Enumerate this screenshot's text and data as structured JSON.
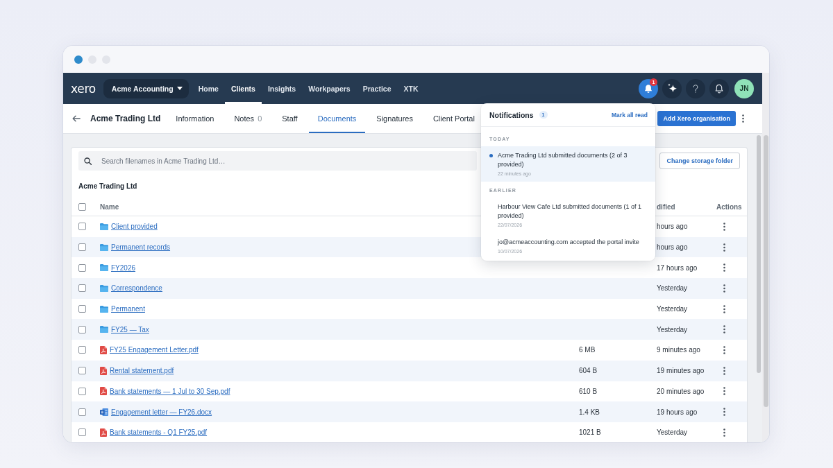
{
  "window": {
    "dots": [
      {
        "color": "#2e8bcb"
      },
      {
        "color": "#e3e5eb"
      },
      {
        "color": "#e3e5eb"
      }
    ]
  },
  "top_nav": {
    "logo": "xero",
    "org_switcher": "Acme Accounting",
    "items": [
      {
        "label": "Home",
        "selected": false
      },
      {
        "label": "Clients",
        "selected": true
      },
      {
        "label": "Insights",
        "selected": false
      },
      {
        "label": "Workpapers",
        "selected": false
      },
      {
        "label": "Practice",
        "selected": false
      },
      {
        "label": "XTK",
        "selected": false
      }
    ],
    "icon_buttons": [
      {
        "kind": "notifications",
        "selected": true,
        "badge": "1"
      },
      {
        "kind": "assistant",
        "selected": false
      },
      {
        "kind": "help",
        "selected": false
      },
      {
        "kind": "alerts",
        "selected": false
      }
    ],
    "avatar": "JN"
  },
  "client_nav": {
    "title": "Acme Trading Ltd",
    "tabs": [
      {
        "label": "Information",
        "selected": false
      },
      {
        "label": "Notes",
        "count": "0",
        "selected": false
      },
      {
        "label": "Staff",
        "selected": false
      },
      {
        "label": "Documents",
        "selected": true
      },
      {
        "label": "Signatures",
        "selected": false
      },
      {
        "label": "Client Portal",
        "selected": false
      }
    ],
    "primary_button": "Add Xero organisation"
  },
  "documents": {
    "search": {
      "placeholder": "Search filenames in Acme Trading Ltd…"
    },
    "storage_button": "Change storage folder",
    "folder_title": "Acme Trading Ltd",
    "table": {
      "select_all_checked": false,
      "headings": {
        "name": "Name",
        "column_4": "dified",
        "actions": "Actions"
      },
      "rows": [
        {
          "kind": "folder",
          "checked": false,
          "name": "Client provided",
          "column_4": "hours ago"
        },
        {
          "kind": "folder",
          "checked": false,
          "name": "Permanent records",
          "column_4": "hours ago"
        },
        {
          "kind": "folder",
          "checked": false,
          "name": "FY2026",
          "column_4": "17 hours ago"
        },
        {
          "kind": "folder",
          "checked": false,
          "name": "Correspondence",
          "column_4": "Yesterday"
        },
        {
          "kind": "folder",
          "checked": false,
          "name": "Permanent",
          "column_4": "Yesterday"
        },
        {
          "kind": "folder",
          "checked": false,
          "name": "FY25 — Tax",
          "column_4": "Yesterday"
        },
        {
          "kind": "pdf",
          "checked": false,
          "name": "FY25 Engagement Letter.pdf",
          "column_3": "6 MB",
          "column_4": "9 minutes ago"
        },
        {
          "kind": "pdf",
          "checked": false,
          "name": "Rental statement.pdf",
          "column_3": "604 B",
          "column_4": "19 minutes ago"
        },
        {
          "kind": "pdf",
          "checked": false,
          "name": "Bank statements — 1 Jul to 30 Sep.pdf",
          "column_3": "610 B",
          "column_4": "20 minutes ago"
        },
        {
          "kind": "docx",
          "checked": false,
          "name": "Engagement letter — FY26.docx",
          "column_3": "1.4 KB",
          "column_4": "19 hours ago"
        },
        {
          "kind": "pdf",
          "checked": false,
          "name": "Bank statements - Q1 FY25.pdf",
          "column_3": "1021 B",
          "column_4": "Yesterday"
        }
      ]
    }
  },
  "notifications": {
    "title": "Notifications",
    "count": "1",
    "mark_all_read": "Mark all read",
    "groups": [
      {
        "label": "TODAY",
        "items": [
          {
            "text": "Acme Trading Ltd submitted documents (2 of 3 provided)",
            "time": "22 minutes ago",
            "unread": true
          }
        ]
      },
      {
        "label": "EARLIER",
        "items": [
          {
            "text": "Harbour View Cafe Ltd submitted documents (1 of 1 provided)",
            "time": "22/07/2026",
            "unread": false
          },
          {
            "text": "jo@acmeaccounting.com accepted the portal invite",
            "time": "10/07/2026",
            "unread": false
          }
        ]
      }
    ]
  }
}
